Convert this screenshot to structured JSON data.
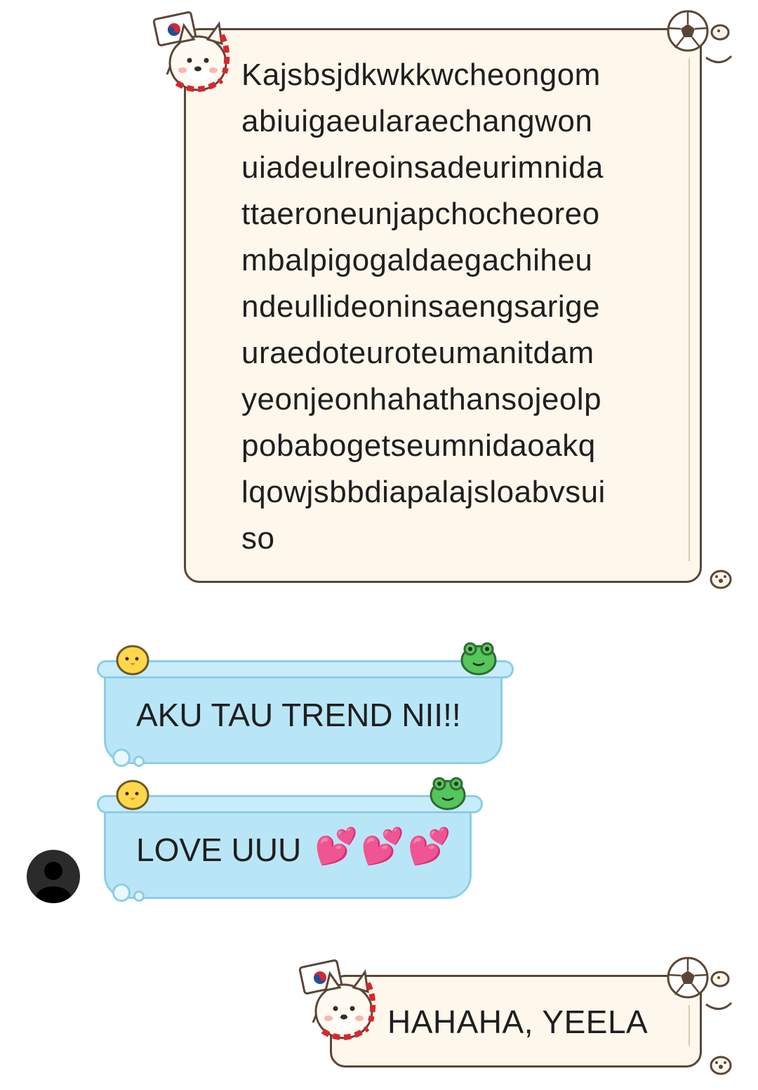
{
  "messages": [
    {
      "direction": "outgoing",
      "text": "Kajsbsjdkwkkwcheongom\nabiuigaeularaechangwon\nuiadeulreoinsadeurimnida\nttaeroneunjapchocheoreo\nmbalpigogaldaegachiheu\nndeullideoninsaengsarige\nuraedoteuroteumanitdam\nyeonjeonhahathansojeolp\npobabogetseumnidaoakq\nlqowjsbbdiapalajsloabvsui\nso"
    },
    {
      "direction": "incoming",
      "text": "AKU TAU TREND NII!!"
    },
    {
      "direction": "incoming",
      "text": "LOVE UUU",
      "emoji": "💕💕💕"
    },
    {
      "direction": "outgoing",
      "text": "HAHAHA, YEELA"
    }
  ],
  "colors": {
    "outgoing_bubble": "#fdf7ec",
    "outgoing_border": "#5b4636",
    "incoming_bubble": "#b9e6f7",
    "incoming_border": "#8dcde8"
  },
  "icons": {
    "dog_sticker": "shiba-dog-with-korea-flag-icon",
    "ball": "soccer-ball-icon",
    "chick": "yellow-chick-icon",
    "frog": "green-frog-icon",
    "avatar": "default-user-avatar-icon"
  }
}
